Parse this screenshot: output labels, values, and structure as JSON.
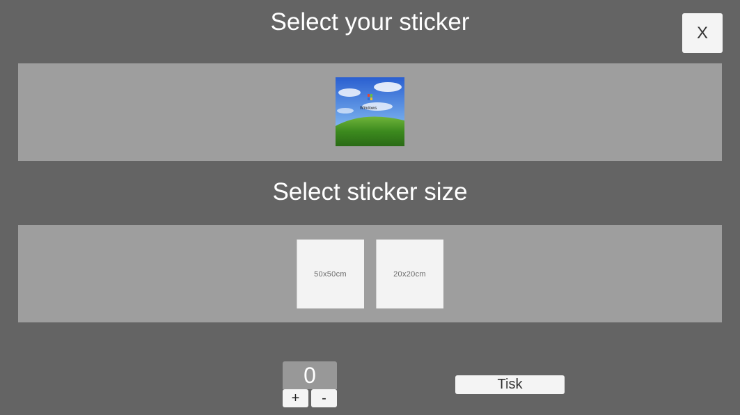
{
  "header": {
    "title": "Select your sticker",
    "close_label": "X"
  },
  "stickers": {
    "items": [
      {
        "name": "windows-xp-bliss",
        "logo_text": "Windows"
      }
    ]
  },
  "size_section": {
    "title": "Select sticker size",
    "options": [
      "50x50cm",
      "20x20cm"
    ]
  },
  "quantity": {
    "value": "0",
    "plus_label": "+",
    "minus_label": "-"
  },
  "print": {
    "label": "Tisk"
  },
  "colors": {
    "background": "#646464",
    "panel": "#9e9e9e",
    "button": "#f4f4f4",
    "counter": "#989898"
  }
}
